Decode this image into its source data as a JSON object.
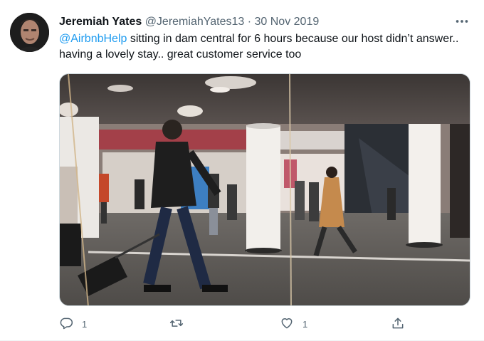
{
  "tweet": {
    "author_name": "Jeremiah Yates",
    "author_handle": "@JeremiahYates13",
    "separator": "·",
    "date": "30 Nov 2019",
    "mention": "@AirbnbHelp",
    "body_text": " sitting in dam central for 6 hours because our host didn’t answer.. having a lovely stay.. great customer service too",
    "more_icon": "more-icon"
  },
  "actions": {
    "reply_count": "1",
    "retweet_count": "",
    "like_count": "1",
    "icons": [
      "reply-icon",
      "retweet-icon",
      "like-icon",
      "share-icon"
    ]
  },
  "colors": {
    "link": "#1d9bf0",
    "secondary_text": "#536471",
    "primary_text": "#0f1419"
  }
}
